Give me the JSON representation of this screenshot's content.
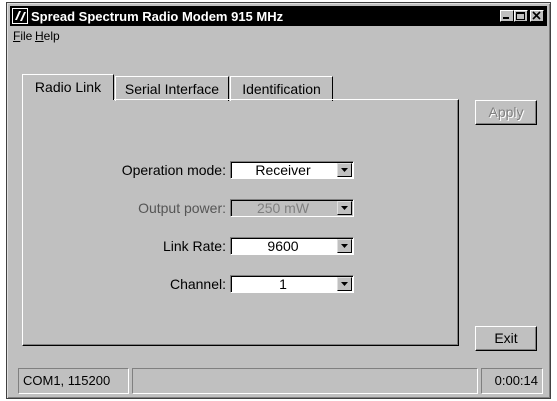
{
  "window": {
    "title": "Spread Spectrum Radio Modem 915 MHz"
  },
  "titlebar_buttons": [
    "minimize-icon",
    "maximize-icon",
    "close-icon"
  ],
  "menu": [
    {
      "label": "File",
      "accel": "F"
    },
    {
      "label": "Help",
      "accel": "H"
    }
  ],
  "tabs": [
    {
      "label": "Radio Link",
      "active": true
    },
    {
      "label": "Serial Interface",
      "active": false
    },
    {
      "label": "Identification",
      "active": false
    }
  ],
  "form": {
    "operation_mode": {
      "label": "Operation mode:",
      "value": "Receiver",
      "enabled": true
    },
    "output_power": {
      "label": "Output power:",
      "value": "250 mW",
      "enabled": false
    },
    "link_rate": {
      "label": "Link Rate:",
      "value": "9600",
      "enabled": true
    },
    "channel": {
      "label": "Channel:",
      "value": "1",
      "enabled": true
    }
  },
  "buttons": {
    "apply": {
      "label": "Apply",
      "enabled": false
    },
    "exit": {
      "label": "Exit",
      "enabled": true
    }
  },
  "status": {
    "port": "COM1, 115200",
    "message": "",
    "elapsed": "0:00:14"
  },
  "colors": {
    "titlebar": "#000000",
    "face": "#c0c0c0"
  }
}
